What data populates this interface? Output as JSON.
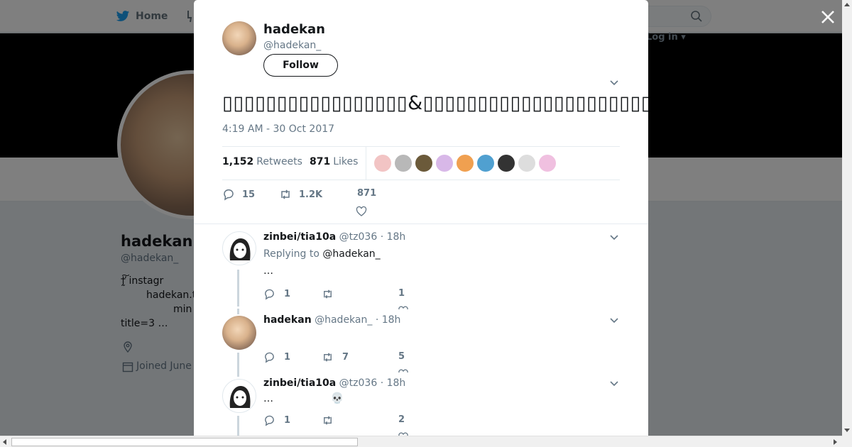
{
  "nav": {
    "home_label": "Home",
    "login_label": "Log in",
    "search_placeholder": ""
  },
  "profile": {
    "name": "hadekan",
    "handle": "@hadekan_",
    "bio_lines": [
      "†̰̕͠     instagr",
      "hadekan.t",
      "min",
      "title=3         …"
    ],
    "joined": "Joined June"
  },
  "tweet": {
    "author_name": "hadekan",
    "author_handle": "@hadekan_",
    "follow_label": "Follow",
    "text": "▯▯▯▯▯▯▯▯▯▯▯▯▯▯▯▯▯&▯▯▯▯▯▯▯▯▯▯▯▯▯▯▯▯▯▯▯▯▯▯▯▯▯▯▯▯▯▯▯▯▯▯▯▯▯▯▯▯▯▯▯▯▯▯▯▯▯▯▯▯▯▯",
    "timestamp": "4:19 AM - 30 Oct 2017",
    "retweets_count": "1,152",
    "retweets_label": "Retweets",
    "likes_count": "871",
    "likes_label": "Likes",
    "action_replies": "15",
    "action_retweets": "1.2K",
    "action_likes": "871"
  },
  "likers_colors": [
    "#f2c4c4",
    "#b8b8b8",
    "#6b5a3a",
    "#d8b8e8",
    "#f0a050",
    "#50a0d0",
    "#333333",
    "#dddddd",
    "#f0c0e0"
  ],
  "replies": [
    {
      "name": "zinbei/tia10a",
      "handle": "@tz036",
      "time": "· 18h",
      "replying_label": "Replying to",
      "replying_to": "@hadekan_",
      "body": "…",
      "replies": "1",
      "retweets": "",
      "likes": "1"
    },
    {
      "name": "hadekan",
      "handle": "@hadekan_",
      "time": "· 18h",
      "body": "",
      "replies": "1",
      "retweets": "7",
      "likes": "5"
    },
    {
      "name": "zinbei/tia10a",
      "handle": "@tz036",
      "time": "· 18h",
      "body": "…",
      "emoji": "💀",
      "replies": "1",
      "retweets": "",
      "likes": "2"
    }
  ]
}
